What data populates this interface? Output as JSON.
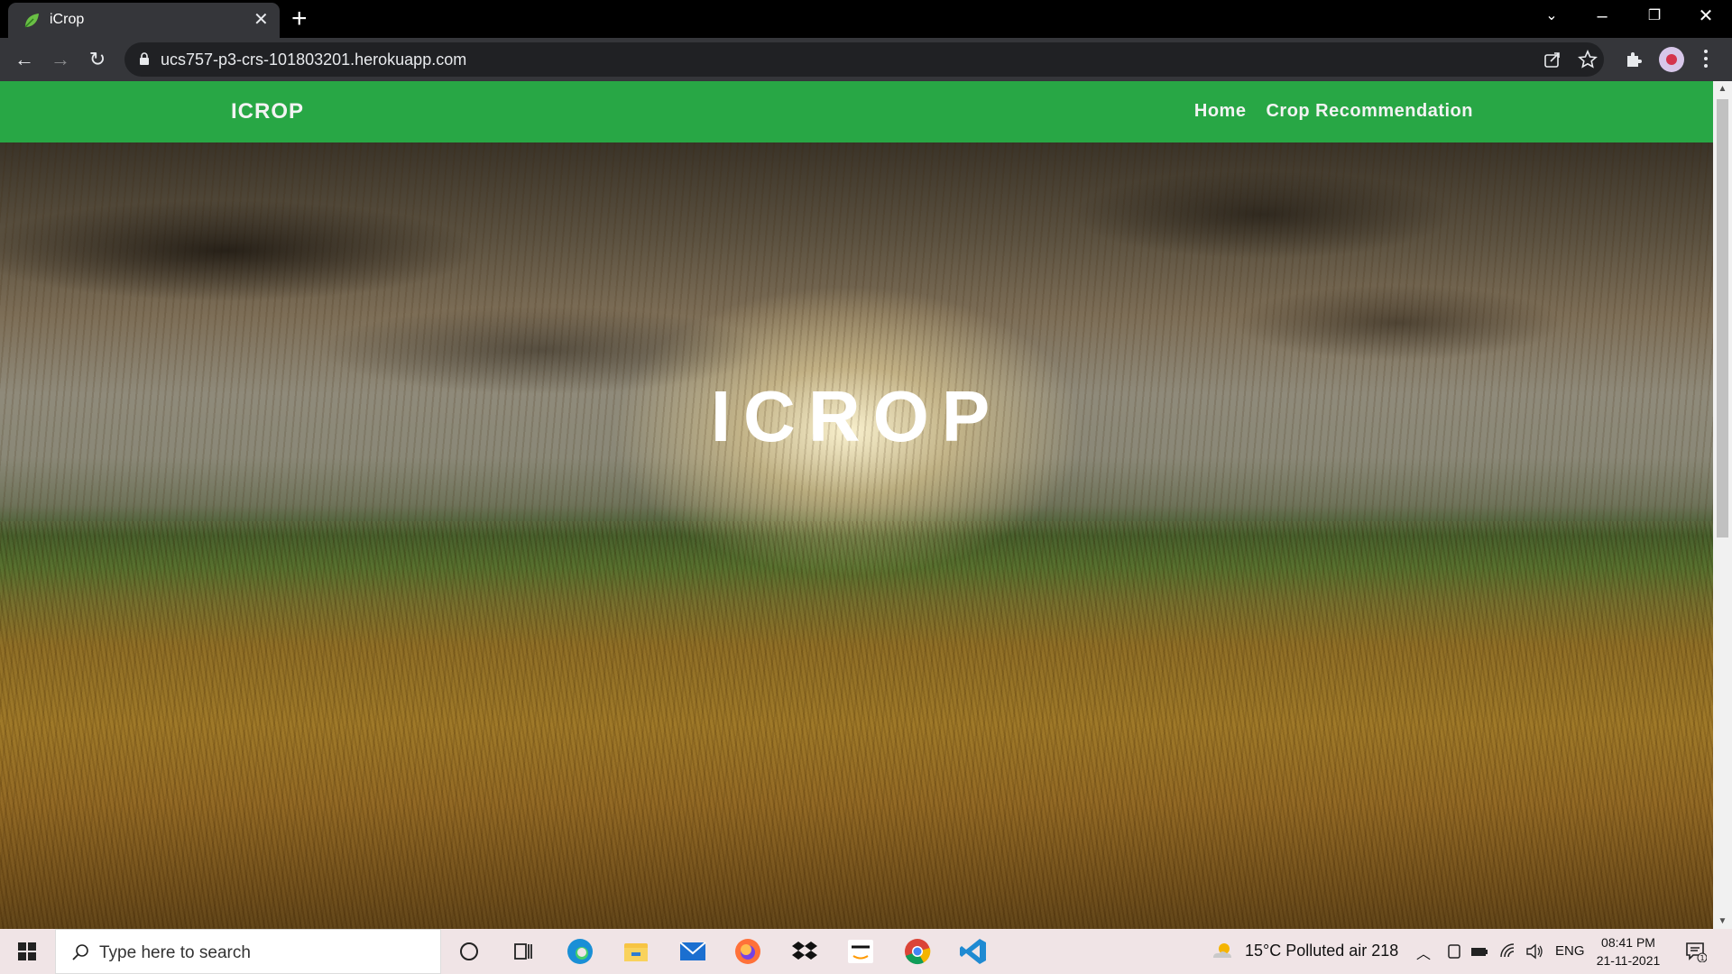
{
  "browser": {
    "tab_title": "iCrop",
    "url": "ucs757-p3-crs-101803201.herokuapp.com"
  },
  "navbar": {
    "brand": "ICROP",
    "links": [
      "Home",
      "Crop Recommendation"
    ]
  },
  "hero": {
    "title": "ICROP"
  },
  "taskbar": {
    "search_placeholder": "Type here to search",
    "weather": "15°C  Polluted air 218",
    "language": "ENG",
    "time": "08:41 PM",
    "date": "21-11-2021",
    "notification_count": "1"
  },
  "colors": {
    "navbar": "#28a745",
    "browser_chrome": "#35363a",
    "taskbar": "#f0e4e6"
  }
}
